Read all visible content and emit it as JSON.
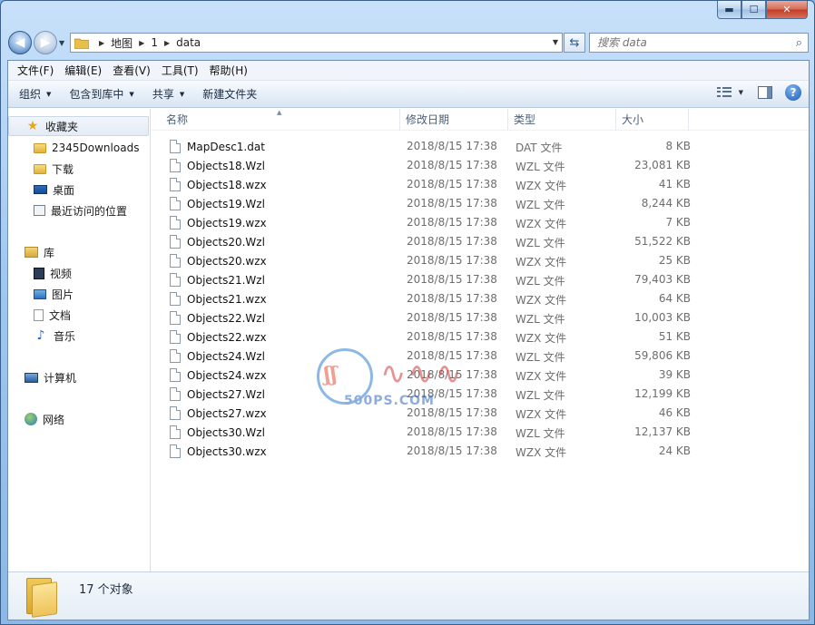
{
  "window": {
    "caption": {
      "minimize": "▬",
      "maximize": "☐",
      "close": "✕"
    }
  },
  "address": {
    "breadcrumbs": [
      "地图",
      "1",
      "data"
    ],
    "search_placeholder": "搜索 data"
  },
  "menu": [
    "文件(F)",
    "编辑(E)",
    "查看(V)",
    "工具(T)",
    "帮助(H)"
  ],
  "commands": {
    "organize": "组织",
    "include_in_library": "包含到库中",
    "share": "共享",
    "new_folder": "新建文件夹"
  },
  "navigation": {
    "favorites": {
      "label": "收藏夹",
      "items": [
        "2345Downloads",
        "下载",
        "桌面",
        "最近访问的位置"
      ]
    },
    "libraries": {
      "label": "库",
      "items": [
        "视频",
        "图片",
        "文档",
        "音乐"
      ]
    },
    "computer": "计算机",
    "network": "网络"
  },
  "columns": {
    "name": "名称",
    "date": "修改日期",
    "type": "类型",
    "size": "大小"
  },
  "files": [
    {
      "name": "MapDesc1.dat",
      "date": "2018/8/15 17:38",
      "type": "DAT 文件",
      "size": "8 KB"
    },
    {
      "name": "Objects18.Wzl",
      "date": "2018/8/15 17:38",
      "type": "WZL 文件",
      "size": "23,081 KB"
    },
    {
      "name": "Objects18.wzx",
      "date": "2018/8/15 17:38",
      "type": "WZX 文件",
      "size": "41 KB"
    },
    {
      "name": "Objects19.Wzl",
      "date": "2018/8/15 17:38",
      "type": "WZL 文件",
      "size": "8,244 KB"
    },
    {
      "name": "Objects19.wzx",
      "date": "2018/8/15 17:38",
      "type": "WZX 文件",
      "size": "7 KB"
    },
    {
      "name": "Objects20.Wzl",
      "date": "2018/8/15 17:38",
      "type": "WZL 文件",
      "size": "51,522 KB"
    },
    {
      "name": "Objects20.wzx",
      "date": "2018/8/15 17:38",
      "type": "WZX 文件",
      "size": "25 KB"
    },
    {
      "name": "Objects21.Wzl",
      "date": "2018/8/15 17:38",
      "type": "WZL 文件",
      "size": "79,403 KB"
    },
    {
      "name": "Objects21.wzx",
      "date": "2018/8/15 17:38",
      "type": "WZX 文件",
      "size": "64 KB"
    },
    {
      "name": "Objects22.Wzl",
      "date": "2018/8/15 17:38",
      "type": "WZL 文件",
      "size": "10,003 KB"
    },
    {
      "name": "Objects22.wzx",
      "date": "2018/8/15 17:38",
      "type": "WZX 文件",
      "size": "51 KB"
    },
    {
      "name": "Objects24.Wzl",
      "date": "2018/8/15 17:38",
      "type": "WZL 文件",
      "size": "59,806 KB"
    },
    {
      "name": "Objects24.wzx",
      "date": "2018/8/15 17:38",
      "type": "WZX 文件",
      "size": "39 KB"
    },
    {
      "name": "Objects27.Wzl",
      "date": "2018/8/15 17:38",
      "type": "WZL 文件",
      "size": "12,199 KB"
    },
    {
      "name": "Objects27.wzx",
      "date": "2018/8/15 17:38",
      "type": "WZX 文件",
      "size": "46 KB"
    },
    {
      "name": "Objects30.Wzl",
      "date": "2018/8/15 17:38",
      "type": "WZL 文件",
      "size": "12,137 KB"
    },
    {
      "name": "Objects30.wzx",
      "date": "2018/8/15 17:38",
      "type": "WZX 文件",
      "size": "24 KB"
    }
  ],
  "status": {
    "count": "17 个对象"
  },
  "watermark": {
    "text": "500PS.COM"
  },
  "colors": {
    "window_frame": "#9fc8f0",
    "accent": "#2f6bb8",
    "close_button": "#c23a22"
  }
}
